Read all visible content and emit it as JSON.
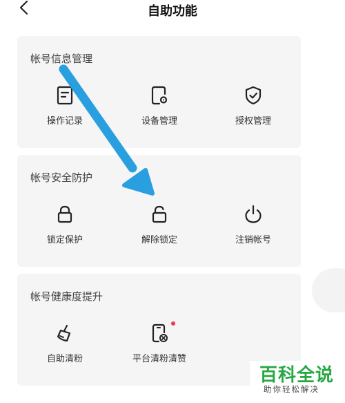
{
  "header": {
    "title": "自助功能"
  },
  "sections": [
    {
      "title": "帐号信息管理",
      "items": [
        {
          "label": "操作记录",
          "icon": "document-icon"
        },
        {
          "label": "设备管理",
          "icon": "device-gear-icon"
        },
        {
          "label": "授权管理",
          "icon": "shield-check-icon"
        }
      ]
    },
    {
      "title": "帐号安全防护",
      "items": [
        {
          "label": "锁定保护",
          "icon": "lock-icon"
        },
        {
          "label": "解除锁定",
          "icon": "unlock-icon"
        },
        {
          "label": "注销帐号",
          "icon": "power-icon"
        }
      ]
    },
    {
      "title": "帐号健康度提升",
      "items": [
        {
          "label": "自助清粉",
          "icon": "brush-icon"
        },
        {
          "label": "平台清粉清赞",
          "icon": "phone-remove-icon",
          "badge": "red-dot"
        }
      ]
    }
  ],
  "colors": {
    "arrow": "#2a9fe0",
    "badge": "#ee3a4e",
    "watermark": "#27a844"
  },
  "watermark": {
    "main": "百科全说",
    "sub": "助你轻松解决"
  }
}
